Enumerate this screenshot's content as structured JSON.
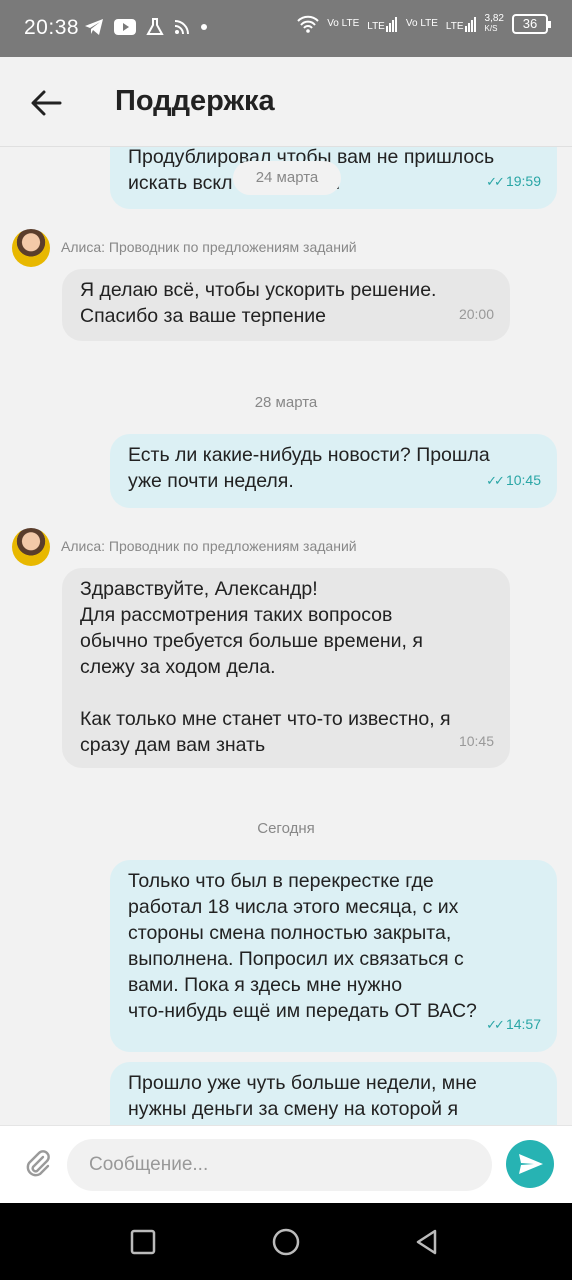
{
  "status_bar": {
    "time": "20:38",
    "network_speed": "3,82",
    "network_unit": "K/S",
    "battery": "36",
    "volte1": "Vo LTE",
    "volte2": "Vo LTE",
    "lte1": "LTE",
    "lte2": "LTE",
    "icons": [
      "telegram-icon",
      "youtube-icon",
      "flask-icon",
      "rss-icon",
      "dot-icon",
      "wifi-icon",
      "signal-icon",
      "battery-icon"
    ]
  },
  "header": {
    "title": "Поддержка"
  },
  "messages": {
    "m1": {
      "text": "Продублировал чтобы вам не пришлось\nискать вскл                 сообщений",
      "time": "19:59"
    },
    "date1": "24 марта",
    "sender1": "Алиса: Проводник по предложениям заданий",
    "m2": {
      "text": "Я делаю всё, чтобы ускорить решение.\nСпасибо за ваше терпение",
      "time": "20:00"
    },
    "date2": "28 марта",
    "m3": {
      "text": "Есть ли какие-нибудь новости? Прошла\nуже почти неделя.",
      "time": "10:45"
    },
    "sender2": "Алиса: Проводник по предложениям заданий",
    "m4": {
      "text": "Здравствуйте, Александр!\nДля рассмотрения таких вопросов\nобычно требуется больше времени, я\nслежу за ходом дела.\n\nКак только мне станет что-то известно, я\nсразу дам вам знать",
      "time": "10:45"
    },
    "date3": "Сегодня",
    "m5": {
      "text": "Только что был в перекрестке где\nработал 18 числа этого месяца, с их\nстороны смена полностью закрыта,\nвыполнена. Попросил их связаться с\nвами. Пока я здесь мне нужно\nчто-нибудь ещё им передать ОТ ВАС?",
      "time": "14:57"
    },
    "m6": {
      "text": "Прошло уже чуть больше недели, мне\nнужны деньги за смену на которой я"
    }
  },
  "composer": {
    "placeholder": "Сообщение..."
  },
  "colors": {
    "accent": "#27b3b3",
    "outgoing_bubble": "#dcf0f4",
    "incoming_bubble": "#e7e7e7"
  }
}
